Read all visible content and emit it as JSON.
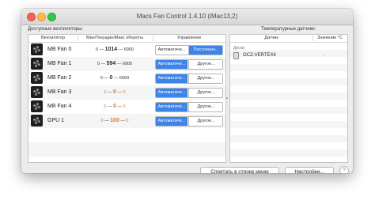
{
  "window": {
    "title": "Macs Fan Control 1.4.10 (iMac13,2)"
  },
  "fans_section": {
    "label": "Доступные вентиляторы:",
    "columns": {
      "fan": "Вентилятор",
      "speed": "Мин/Текущие/Макс обороты",
      "control": "Управление"
    },
    "rows": [
      {
        "name": "MB Fan 0",
        "min": "0",
        "current": "1014",
        "max": "6000",
        "mode1": "Автоматиче...",
        "mode2": "Постоянно...",
        "active": 2,
        "state": "normal"
      },
      {
        "name": "MB Fan 1",
        "min": "0",
        "current": "594",
        "max": "6000",
        "mode1": "Автоматиче...",
        "mode2": "Другое...",
        "active": 1,
        "state": "normal"
      },
      {
        "name": "MB Fan 2",
        "min": "0",
        "current": "0",
        "max": "6000",
        "mode1": "Автоматиче...",
        "mode2": "Другое...",
        "active": 1,
        "state": "normal"
      },
      {
        "name": "MB Fan 3",
        "min": "0",
        "current": "0",
        "max": "0",
        "mode1": "Автоматиче...",
        "mode2": "Другое...",
        "active": 1,
        "state": "inactive"
      },
      {
        "name": "MB Fan 4",
        "min": "0",
        "current": "0",
        "max": "0",
        "mode1": "Автоматиче...",
        "mode2": "Другое...",
        "active": 1,
        "state": "inactive"
      },
      {
        "name": "GPU 1",
        "min": "0",
        "current": "100",
        "max": "0",
        "mode1": "Автоматиче...",
        "mode2": "Другое...",
        "active": 1,
        "state": "inactive"
      }
    ]
  },
  "sensors_section": {
    "label": "Температурные датчики:",
    "columns": {
      "sensor": "Датчик",
      "value": "Значение °C"
    },
    "group": "Диски:",
    "rows": [
      {
        "name": "OCZ-VERTEX4",
        "value": "-"
      }
    ]
  },
  "footer": {
    "hide_button": "Спрятать в строке меню",
    "settings_button": "Настройки...",
    "help": "?"
  },
  "colors": {
    "accent": "#3d84e8",
    "inactive_speed": "#e07a12"
  },
  "icons": {
    "fan": "fan-icon",
    "disk": "hdd-icon"
  }
}
